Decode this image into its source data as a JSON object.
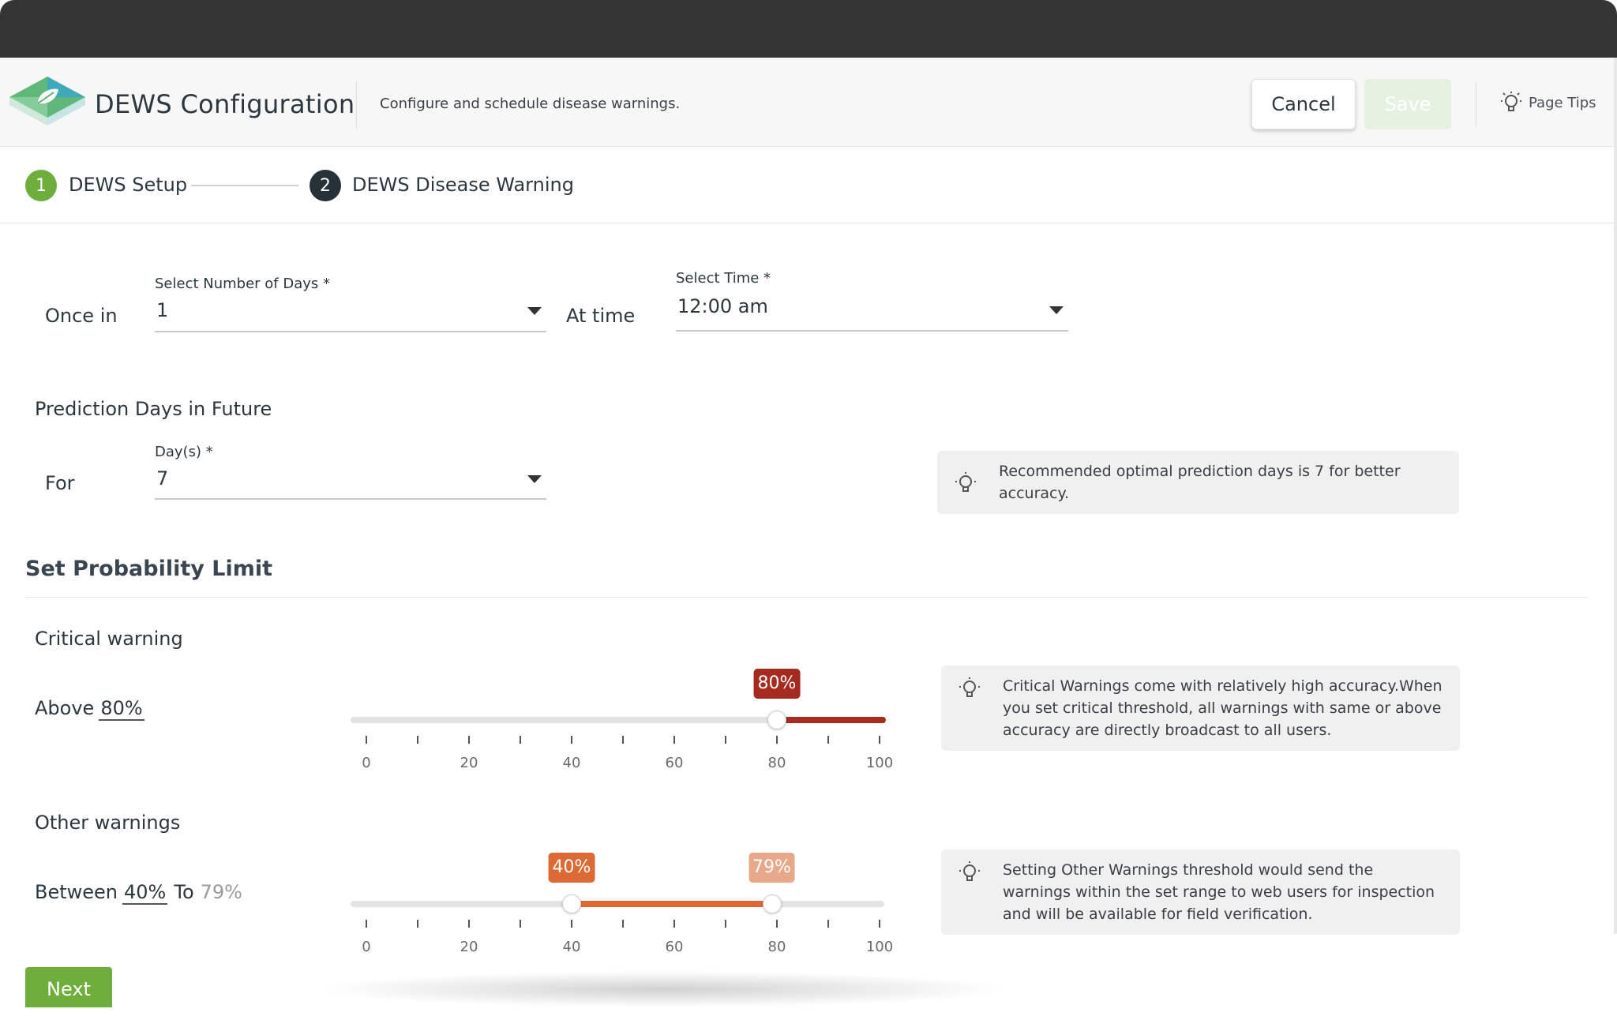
{
  "header": {
    "app_title": "DEWS Configuration",
    "subtitle": "Configure and schedule disease warnings.",
    "cancel_label": "Cancel",
    "save_label": "Save",
    "page_tips_label": "Page Tips",
    "page_tips_icon": "lightbulb-icon",
    "logo_icon": "leaf-logo-icon"
  },
  "stepper": {
    "steps": [
      {
        "number": "1",
        "label": "DEWS Setup",
        "state": "completed",
        "color": "#6eae3d"
      },
      {
        "number": "2",
        "label": "DEWS Disease Warning",
        "state": "active",
        "color": "#263238"
      }
    ]
  },
  "schedule": {
    "once_in_label": "Once in",
    "days_field_label": "Select Number of Days *",
    "days_value": "1",
    "at_time_label": "At time",
    "time_field_label": "Select Time *",
    "time_value": "12:00 am"
  },
  "prediction": {
    "title": "Prediction Days in Future",
    "for_label": "For",
    "days_field_label": "Day(s) *",
    "days_value": "7",
    "tip": "Recommended optimal prediction days is 7 for better accuracy."
  },
  "probability": {
    "section_title": "Set Probability Limit",
    "critical": {
      "title": "Critical warning",
      "prefix": "Above",
      "value_text": "80%",
      "threshold": 80,
      "badge": "80%",
      "color": "#a52a1f",
      "tip": "Critical Warnings come with relatively high accuracy.When you set critical threshold, all warnings with same or above accuracy are directly broadcast to all users."
    },
    "other": {
      "title": "Other warnings",
      "prefix": "Between",
      "low_text": "40%",
      "to_label": "To",
      "high_text": "79%",
      "low": 40,
      "high": 79,
      "low_badge": "40%",
      "high_badge": "79%",
      "color": "#dd6a35",
      "high_badge_color": "#e8a88a",
      "tip": "Setting Other Warnings threshold would send the warnings within the set range to web users for inspection and will be available for field verification."
    },
    "scale": {
      "min": 0,
      "max": 100,
      "labels": [
        "0",
        "20",
        "40",
        "60",
        "80",
        "100"
      ]
    }
  },
  "footer": {
    "next_label": "Next"
  }
}
